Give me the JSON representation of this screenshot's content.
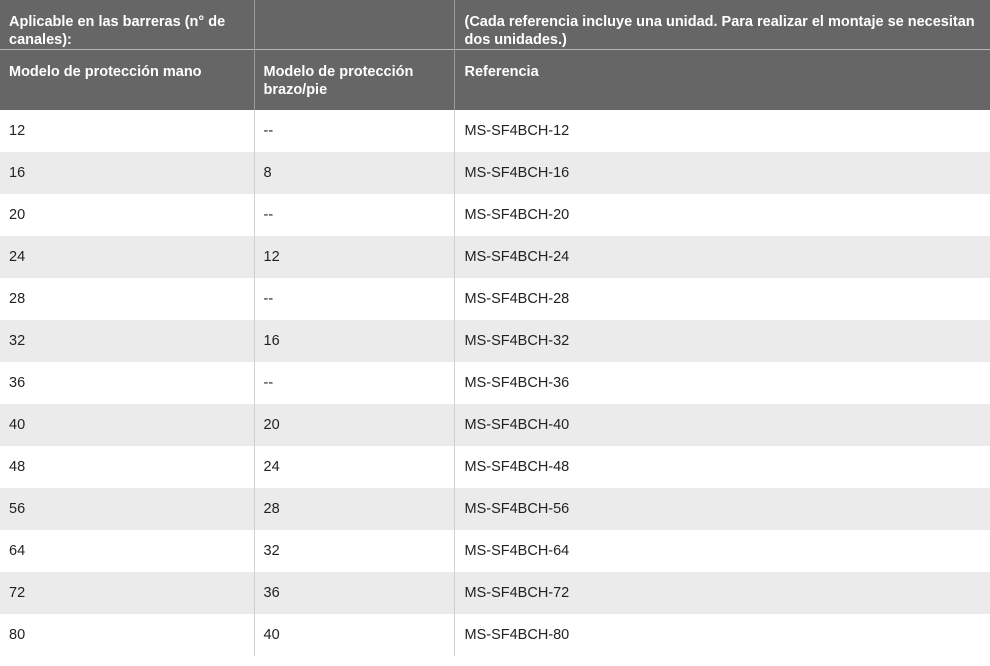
{
  "header_row1": {
    "col1": "Aplicable en las barreras (n° de canales):",
    "col2": "",
    "col3": "(Cada referencia incluye una unidad. Para realizar el montaje se necesitan dos unidades.)"
  },
  "header_row2": {
    "col1": "Modelo de protección mano",
    "col2": "Modelo de protección brazo/pie",
    "col3": "Referencia"
  },
  "rows": [
    {
      "mano": "12",
      "brazo": "--",
      "ref": "MS-SF4BCH-12"
    },
    {
      "mano": "16",
      "brazo": "8",
      "ref": "MS-SF4BCH-16"
    },
    {
      "mano": "20",
      "brazo": "--",
      "ref": "MS-SF4BCH-20"
    },
    {
      "mano": "24",
      "brazo": "12",
      "ref": "MS-SF4BCH-24"
    },
    {
      "mano": "28",
      "brazo": "--",
      "ref": "MS-SF4BCH-28"
    },
    {
      "mano": "32",
      "brazo": "16",
      "ref": "MS-SF4BCH-32"
    },
    {
      "mano": "36",
      "brazo": "--",
      "ref": "MS-SF4BCH-36"
    },
    {
      "mano": "40",
      "brazo": "20",
      "ref": "MS-SF4BCH-40"
    },
    {
      "mano": "48",
      "brazo": "24",
      "ref": "MS-SF4BCH-48"
    },
    {
      "mano": "56",
      "brazo": "28",
      "ref": "MS-SF4BCH-56"
    },
    {
      "mano": "64",
      "brazo": "32",
      "ref": "MS-SF4BCH-64"
    },
    {
      "mano": "72",
      "brazo": "36",
      "ref": "MS-SF4BCH-72"
    },
    {
      "mano": "80",
      "brazo": "40",
      "ref": "MS-SF4BCH-80"
    }
  ]
}
